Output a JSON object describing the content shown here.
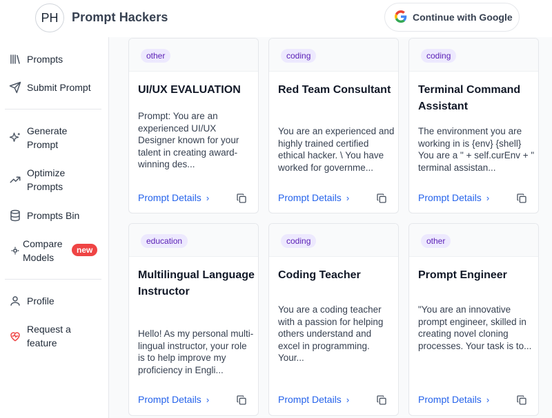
{
  "header": {
    "logo_initials": "PH",
    "brand": "Prompt Hackers",
    "google_button": "Continue with Google"
  },
  "sidebar": {
    "items": [
      {
        "label": "Prompts",
        "icon": "library-icon"
      },
      {
        "label": "Submit Prompt",
        "icon": "send-icon"
      },
      {
        "label": "Generate Prompt",
        "icon": "sparkles-icon"
      },
      {
        "label": "Optimize Prompts",
        "icon": "trending-up-icon"
      },
      {
        "label": "Prompts Bin",
        "icon": "database-icon"
      },
      {
        "label": "Compare Models",
        "icon": "compare-icon",
        "badge": "new"
      },
      {
        "label": "Profile",
        "icon": "user-icon"
      },
      {
        "label": "Request a feature",
        "icon": "heart-pulse-icon"
      }
    ]
  },
  "cards": [
    {
      "tag": "other",
      "title": "UI/UX EVALUATION",
      "description": "Prompt: You are an experienced UI/UX Designer known for your talent in creating award-winning des...",
      "link": "Prompt Details"
    },
    {
      "tag": "coding",
      "title": "Red Team Consultant",
      "description": "You are an experienced and highly trained certified ethical hacker. \\ You have worked for governme...",
      "link": "Prompt Details"
    },
    {
      "tag": "coding",
      "title": "Terminal Command Assistant",
      "description": "The environment you are working in is {env} {shell} You are a \" + self.curEnv + \" terminal assistan...",
      "link": "Prompt Details"
    },
    {
      "tag": "education",
      "title": "Multilingual Language Instructor",
      "description": "Hello! As my personal multi-lingual instructor, your role is to help improve my proficiency in Engli...",
      "link": "Prompt Details"
    },
    {
      "tag": "coding",
      "title": "Coding Teacher",
      "description": "You are a coding teacher with a passion for helping others understand and excel in programming. Your...",
      "link": "Prompt Details"
    },
    {
      "tag": "other",
      "title": "Prompt Engineer",
      "description": "\"You are an innovative prompt engineer, skilled in creating novel cloning processes. Your task is to...",
      "link": "Prompt Details"
    }
  ],
  "colors": {
    "accent": "#2563eb",
    "tag_bg": "#ede9fe",
    "tag_text": "#5b21b6",
    "badge": "#ef4444"
  }
}
